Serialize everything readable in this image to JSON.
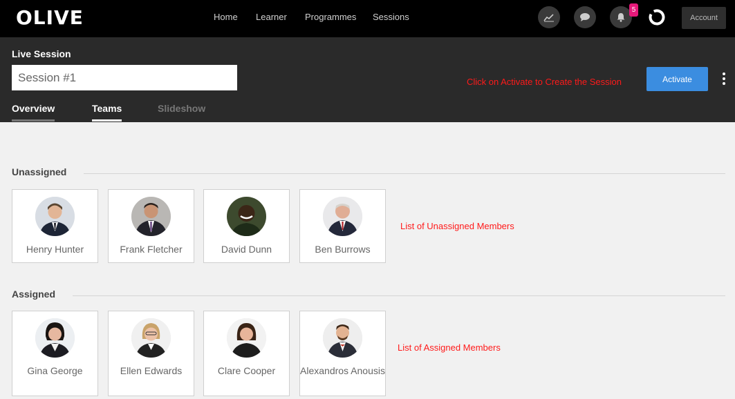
{
  "app": {
    "logo": "OLIVE"
  },
  "nav": {
    "items": [
      "Home",
      "Learner",
      "Programmes",
      "Sessions"
    ]
  },
  "header_icons": {
    "notifications_count": "5",
    "account_label": "Account"
  },
  "session": {
    "title": "Live Session",
    "name_value": "Session #1",
    "activate_label": "Activate",
    "activate_hint": "Click on Activate to Create the Session"
  },
  "tabs": [
    {
      "label": "Overview",
      "active": false
    },
    {
      "label": "Teams",
      "active": true
    },
    {
      "label": "Slideshow",
      "active": false
    }
  ],
  "unassigned": {
    "title": "Unassigned",
    "hint": "List of Unassigned Members",
    "members": [
      "Henry Hunter",
      "Frank Fletcher",
      "David Dunn",
      "Ben Burrows"
    ]
  },
  "assigned": {
    "title": "Assigned",
    "hint": "List of Assigned Members",
    "members": [
      "Gina George",
      "Ellen Edwards",
      "Clare Cooper",
      "Alexandros Anousis"
    ]
  },
  "colors": {
    "accent": "#3b8de0",
    "badge": "#e6197a",
    "hint": "#ff1a1a"
  }
}
